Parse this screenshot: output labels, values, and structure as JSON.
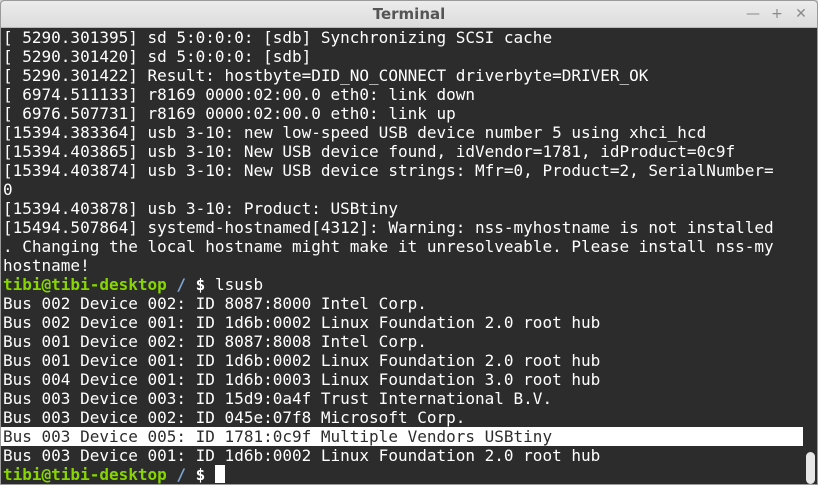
{
  "window": {
    "title": "Terminal",
    "controls": {
      "minimize": "—",
      "maximize": "+",
      "close": "✕"
    }
  },
  "terminal": {
    "lines": [
      "[ 5290.301395] sd 5:0:0:0: [sdb] Synchronizing SCSI cache",
      "[ 5290.301420] sd 5:0:0:0: [sdb]",
      "[ 5290.301422] Result: hostbyte=DID_NO_CONNECT driverbyte=DRIVER_OK",
      "[ 6974.511133] r8169 0000:02:00.0 eth0: link down",
      "[ 6976.507731] r8169 0000:02:00.0 eth0: link up",
      "[15394.383364] usb 3-10: new low-speed USB device number 5 using xhci_hcd",
      "[15394.403865] usb 3-10: New USB device found, idVendor=1781, idProduct=0c9f",
      "[15394.403874] usb 3-10: New USB device strings: Mfr=0, Product=2, SerialNumber=",
      "0",
      "[15394.403878] usb 3-10: Product: USBtiny",
      "[15494.507864] systemd-hostnamed[4312]: Warning: nss-myhostname is not installed",
      ". Changing the local hostname might make it unresolveable. Please install nss-my",
      "hostname!"
    ],
    "prompt": {
      "user_host": "tibi@tibi-desktop",
      "path": " / ",
      "dollar": "$",
      "command": " lsusb"
    },
    "lsusb_output": [
      "Bus 002 Device 002: ID 8087:8000 Intel Corp.",
      "Bus 002 Device 001: ID 1d6b:0002 Linux Foundation 2.0 root hub",
      "Bus 001 Device 002: ID 8087:8008 Intel Corp.",
      "Bus 001 Device 001: ID 1d6b:0002 Linux Foundation 2.0 root hub",
      "Bus 004 Device 001: ID 1d6b:0003 Linux Foundation 3.0 root hub",
      "Bus 003 Device 003: ID 15d9:0a4f Trust International B.V.",
      "Bus 003 Device 002: ID 045e:07f8 Microsoft Corp.",
      "Bus 003 Device 005: ID 1781:0c9f Multiple Vendors USBtiny",
      "Bus 003 Device 001: ID 1d6b:0002 Linux Foundation 2.0 root hub"
    ],
    "selected_output_index": 7,
    "final_prompt": {
      "user_host": "tibi@tibi-desktop",
      "path": " / ",
      "dollar": "$"
    }
  },
  "colors": {
    "background": "#2c2c2c",
    "text": "#ffffff",
    "user_host": "#87d600",
    "path": "#7fa7d6",
    "selection": "#ffffff"
  }
}
